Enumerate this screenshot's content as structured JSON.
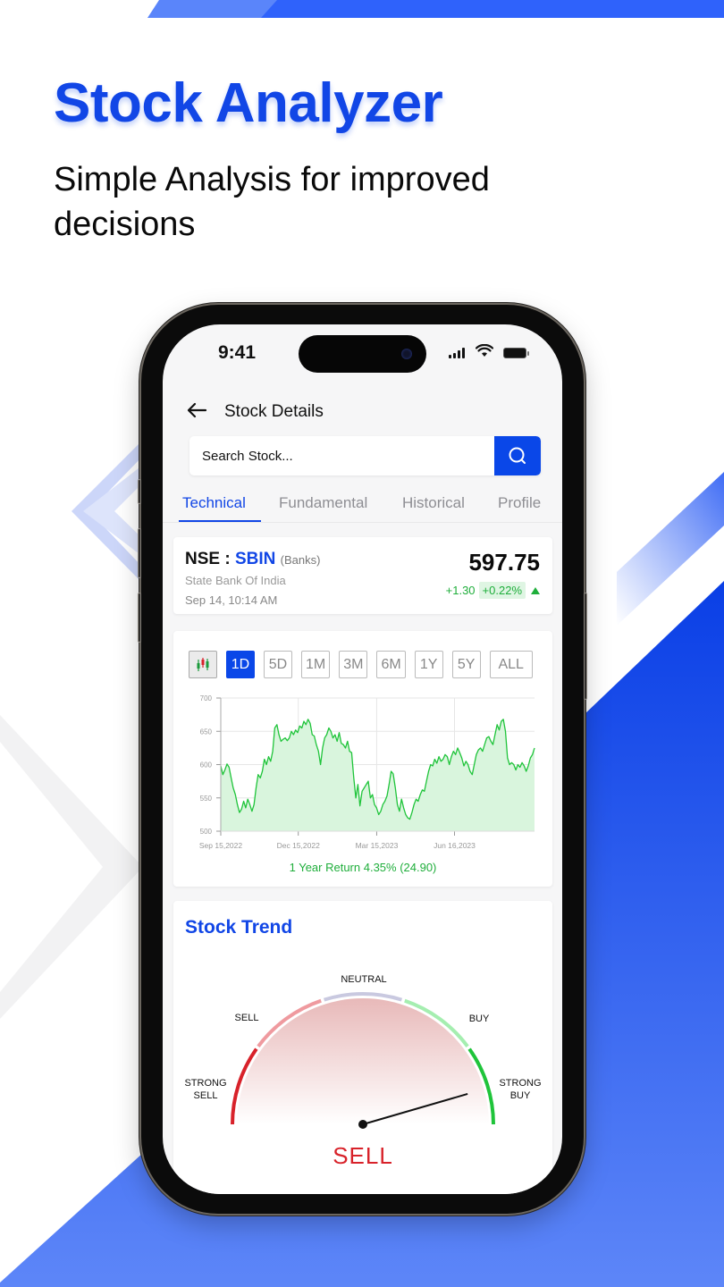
{
  "hero": {
    "title": "Stock Analyzer",
    "subtitle": "Simple Analysis for improved decisions"
  },
  "colors": {
    "brand_blue": "#1146e6",
    "button_blue": "#0a47e8",
    "positive_green": "#1fae3b",
    "sell_red": "#d8222a"
  },
  "status_bar": {
    "time": "9:41",
    "icons": [
      "signal-icon",
      "wifi-icon",
      "battery-icon"
    ]
  },
  "app_bar": {
    "back_icon": "arrow-left-icon",
    "title": "Stock Details"
  },
  "search": {
    "placeholder": "Search Stock...",
    "value": "",
    "button_icon": "search-icon"
  },
  "tabs": [
    {
      "label": "Technical",
      "active": true
    },
    {
      "label": "Fundamental",
      "active": false
    },
    {
      "label": "Historical",
      "active": false
    },
    {
      "label": "Profile",
      "active": false
    }
  ],
  "quote": {
    "exchange": "NSE",
    "separator": " : ",
    "symbol": "SBIN",
    "sector": "(Banks)",
    "company": "State Bank Of India",
    "datetime": "Sep 14, 10:14 AM",
    "price": "597.75",
    "change": "+1.30",
    "change_pct": "+0.22%",
    "direction": "up"
  },
  "chart_controls": {
    "chart_type_icon": "candlestick-icon",
    "ranges": [
      {
        "label": "1D",
        "active": true
      },
      {
        "label": "5D",
        "active": false
      },
      {
        "label": "1M",
        "active": false
      },
      {
        "label": "3M",
        "active": false
      },
      {
        "label": "6M",
        "active": false
      },
      {
        "label": "1Y",
        "active": false
      },
      {
        "label": "5Y",
        "active": false
      },
      {
        "label": "ALL",
        "active": false
      }
    ]
  },
  "chart_data": {
    "type": "area",
    "title": "",
    "xlabel": "",
    "ylabel": "",
    "ylim": [
      500,
      700
    ],
    "yticks": [
      500,
      550,
      600,
      650,
      700
    ],
    "xticks": [
      "Sep 15,2022",
      "Dec 15,2022",
      "Mar 15,2023",
      "Jun 16,2023"
    ],
    "xtick_positions": [
      0,
      0.247,
      0.497,
      0.745
    ],
    "grid": true,
    "series": [
      {
        "name": "SBIN",
        "color": "#1fc43a",
        "values": [
          598,
          585,
          592,
          601,
          596,
          580,
          565,
          555,
          540,
          528,
          533,
          545,
          535,
          548,
          540,
          530,
          540,
          565,
          585,
          580,
          590,
          608,
          600,
          612,
          605,
          620,
          655,
          660,
          645,
          635,
          638,
          640,
          636,
          640,
          650,
          645,
          652,
          648,
          658,
          655,
          665,
          660,
          668,
          662,
          645,
          643,
          630,
          620,
          600,
          625,
          640,
          645,
          655,
          650,
          640,
          645,
          635,
          648,
          632,
          630,
          625,
          635,
          620,
          618,
          580,
          550,
          570,
          538,
          560,
          565,
          570,
          575,
          550,
          555,
          540,
          535,
          525,
          530,
          540,
          545,
          553,
          570,
          590,
          586,
          565,
          540,
          530,
          548,
          535,
          525,
          520,
          518,
          528,
          540,
          548,
          545,
          555,
          562,
          560,
          575,
          590,
          600,
          598,
          608,
          602,
          612,
          605,
          608,
          615,
          612,
          600,
          612,
          620,
          615,
          625,
          618,
          610,
          598,
          605,
          600,
          590,
          585,
          600,
          615,
          622,
          625,
          620,
          630,
          640,
          642,
          635,
          630,
          645,
          660,
          652,
          665,
          668,
          650,
          610,
          600,
          603,
          600,
          592,
          600,
          596,
          603,
          598,
          590,
          598,
          610,
          615,
          625
        ]
      }
    ]
  },
  "chart_footer": {
    "return_text": "1 Year Return 4.35% (24.90)"
  },
  "trend": {
    "title": "Stock Trend",
    "segments": [
      {
        "label": "STRONG SELL",
        "line1": "STRONG",
        "line2": "SELL",
        "color": "#d8222a"
      },
      {
        "label": "SELL",
        "color": "#ef9a9f"
      },
      {
        "label": "NEUTRAL",
        "color": "#c9c9e0"
      },
      {
        "label": "BUY",
        "color": "#a5eeb0"
      },
      {
        "label": "STRONG BUY",
        "line1": "STRONG",
        "line2": "BUY",
        "color": "#1fc43a"
      }
    ],
    "needle_value": 0.91,
    "verdict": "SELL"
  }
}
